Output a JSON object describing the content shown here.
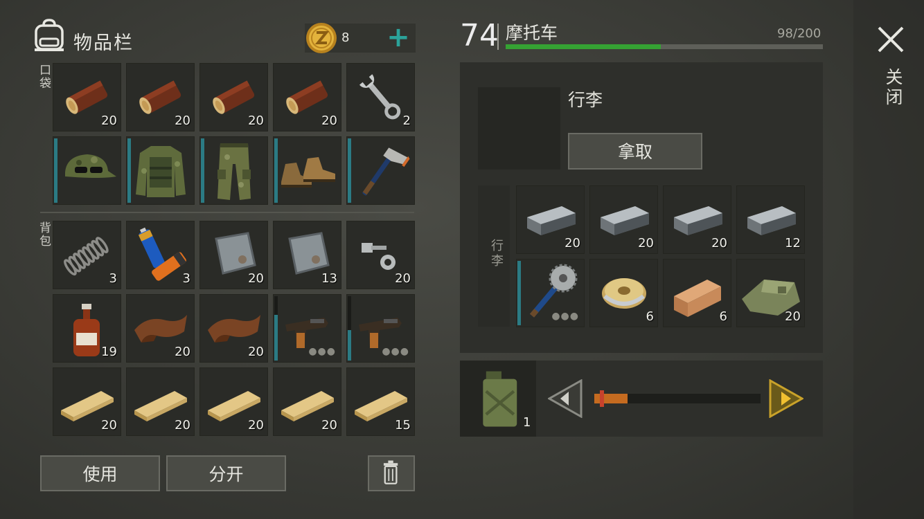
{
  "inventory": {
    "title": "物品栏",
    "coins": "8",
    "add_coins_label": "+",
    "pocket_label": "口袋",
    "backpack_label": "背包",
    "pockets": [
      {
        "item": "log-icon",
        "qty": "20",
        "dura": false
      },
      {
        "item": "log-icon",
        "qty": "20",
        "dura": false
      },
      {
        "item": "log-icon",
        "qty": "20",
        "dura": false
      },
      {
        "item": "log-icon",
        "qty": "20",
        "dura": false
      },
      {
        "item": "wrench-icon",
        "qty": "2",
        "dura": false
      },
      {
        "item": "camo-cap-icon",
        "qty": "",
        "dura": true
      },
      {
        "item": "camo-jacket-icon",
        "qty": "",
        "dura": true
      },
      {
        "item": "camo-pants-icon",
        "qty": "",
        "dura": true
      },
      {
        "item": "boots-icon",
        "qty": "",
        "dura": true
      },
      {
        "item": "hatchet-icon",
        "qty": "",
        "dura": true
      }
    ],
    "backpack": [
      {
        "item": "spring-icon",
        "qty": "3"
      },
      {
        "item": "battery-icon",
        "qty": "3"
      },
      {
        "item": "metal-plate-icon",
        "qty": "20"
      },
      {
        "item": "metal-plate-icon",
        "qty": "13"
      },
      {
        "item": "bolt-nut-icon",
        "qty": "20"
      },
      {
        "item": "bottle-icon",
        "qty": "19"
      },
      {
        "item": "leather-icon",
        "qty": "20"
      },
      {
        "item": "leather-icon",
        "qty": "20"
      },
      {
        "item": "pistol-icon",
        "qty": "",
        "more": true
      },
      {
        "item": "pistol-icon",
        "qty": "",
        "more": true
      },
      {
        "item": "plank-icon",
        "qty": "20"
      },
      {
        "item": "plank-icon",
        "qty": "20"
      },
      {
        "item": "plank-icon",
        "qty": "20"
      },
      {
        "item": "plank-icon",
        "qty": "20"
      },
      {
        "item": "plank-icon",
        "qty": "15"
      }
    ],
    "use_label": "使用",
    "split_label": "分开"
  },
  "vehicle": {
    "level": "74",
    "name": "摩托车",
    "capacity": "98/200",
    "capacity_fraction": 0.49,
    "cargo_title": "行李",
    "take_label": "拿取",
    "cargo_side_label": "行李",
    "cargo": [
      {
        "item": "iron-bar-icon",
        "qty": "20"
      },
      {
        "item": "iron-bar-icon",
        "qty": "20"
      },
      {
        "item": "iron-bar-icon",
        "qty": "20"
      },
      {
        "item": "iron-bar-icon",
        "qty": "12"
      },
      {
        "item": "saw-club-icon",
        "qty": "",
        "more": true
      },
      {
        "item": "wire-spool-icon",
        "qty": "6"
      },
      {
        "item": "wood-block-icon",
        "qty": "6"
      },
      {
        "item": "cloth-icon",
        "qty": "20"
      }
    ],
    "fuel_qty": "1",
    "fuel_fraction": 0.2
  },
  "close_label": "关闭",
  "colors": {
    "accent": "#2ba39a",
    "fuel": "#c56b20",
    "capacity": "#35a233",
    "durability": "#2b7b84"
  }
}
